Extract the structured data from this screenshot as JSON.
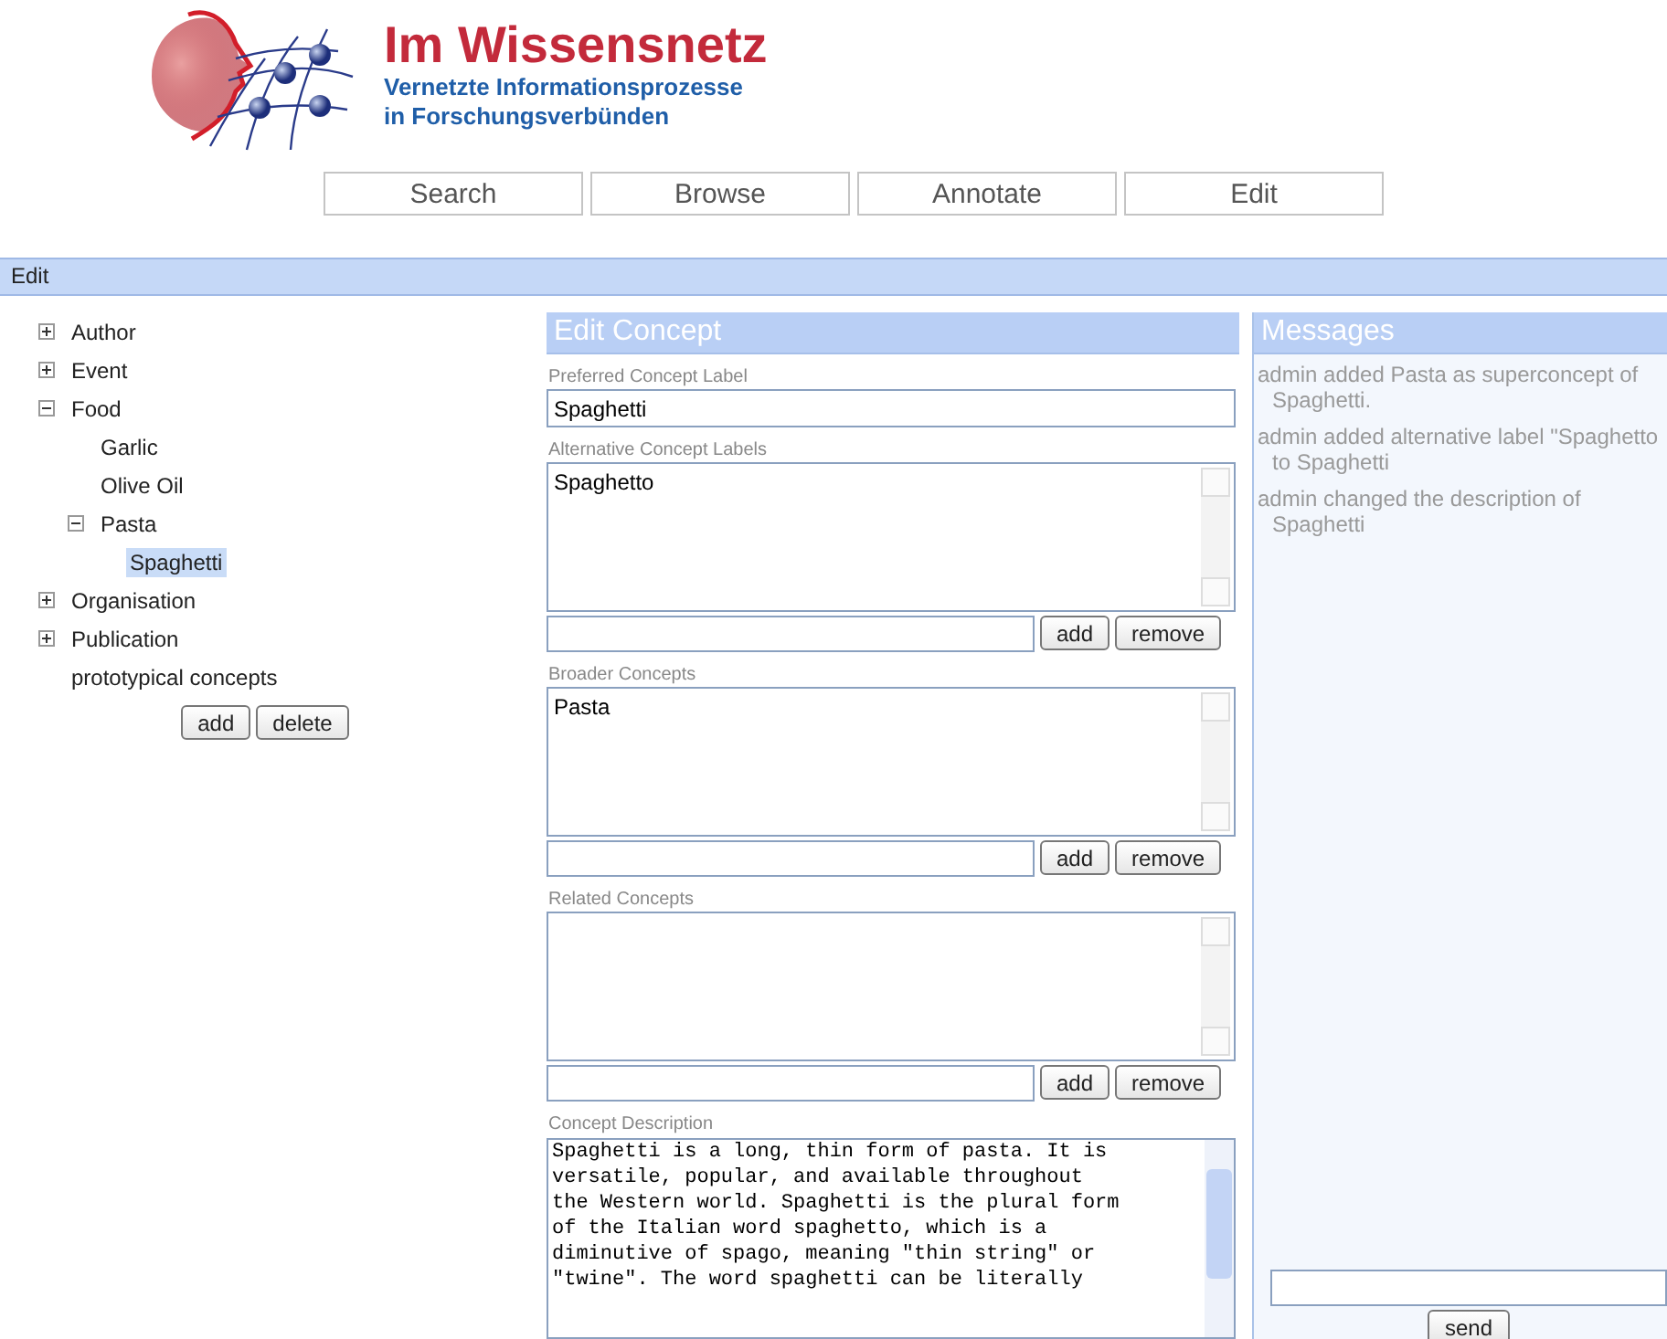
{
  "logo": {
    "title": "Im Wissensnetz",
    "subtitle_lines": [
      "Vernetzte Informationsprozesse",
      "in Forschungsverbünden"
    ]
  },
  "nav": [
    {
      "label": "Search"
    },
    {
      "label": "Browse"
    },
    {
      "label": "Annotate"
    },
    {
      "label": "Edit"
    }
  ],
  "section_bar": {
    "title": "Edit"
  },
  "tree": {
    "items": [
      {
        "label": "Author",
        "kind": "node",
        "expanded": false,
        "selected": false
      },
      {
        "label": "Event",
        "kind": "node",
        "expanded": false,
        "selected": false
      },
      {
        "label": "Food",
        "kind": "node",
        "expanded": true,
        "selected": false,
        "children": [
          {
            "label": "Garlic",
            "kind": "leaf",
            "selected": false
          },
          {
            "label": "Olive Oil",
            "kind": "leaf",
            "selected": false
          },
          {
            "label": "Pasta",
            "kind": "node",
            "expanded": true,
            "selected": false,
            "children": [
              {
                "label": "Spaghetti",
                "kind": "leaf",
                "selected": true
              }
            ]
          }
        ]
      },
      {
        "label": "Organisation",
        "kind": "node",
        "expanded": false,
        "selected": false
      },
      {
        "label": "Publication",
        "kind": "node",
        "expanded": false,
        "selected": false
      },
      {
        "label": "prototypical concepts",
        "kind": "leaf",
        "selected": false
      }
    ],
    "buttons": [
      "add",
      "delete"
    ]
  },
  "editor": {
    "title": "Edit Concept",
    "fields": [
      {
        "kind": "text",
        "label": "Preferred Concept Label",
        "value": "Spaghetti"
      },
      {
        "kind": "list",
        "label": "Alternative Concept Labels",
        "items": [
          "Spaghetto"
        ],
        "buttons": [
          "add",
          "remove"
        ]
      },
      {
        "kind": "list",
        "label": "Broader Concepts",
        "items": [
          "Pasta"
        ],
        "buttons": [
          "add",
          "remove"
        ]
      },
      {
        "kind": "list",
        "label": "Related Concepts",
        "buttons": [
          "add",
          "remove"
        ]
      },
      {
        "kind": "description",
        "label": "Concept Description",
        "value_lines": [
          "Spaghetti is a long, thin form of pasta. It is",
          "versatile, popular, and available throughout",
          "the Western world. Spaghetti is the plural form",
          "of the Italian word spaghetto, which is a",
          "diminutive of spago, meaning \"thin string\" or",
          "\"twine\". The word spaghetti can be literally"
        ]
      }
    ]
  },
  "messages": {
    "title": "Messages",
    "items": [
      {
        "lines": [
          "admin added Pasta as superconcept of",
          "Spaghetti."
        ]
      },
      {
        "lines": [
          "admin added alternative label \"Spaghetto",
          "to Spaghetti"
        ]
      },
      {
        "lines": [
          "admin changed the description of",
          "Spaghetti"
        ]
      }
    ],
    "send_button": "send"
  }
}
